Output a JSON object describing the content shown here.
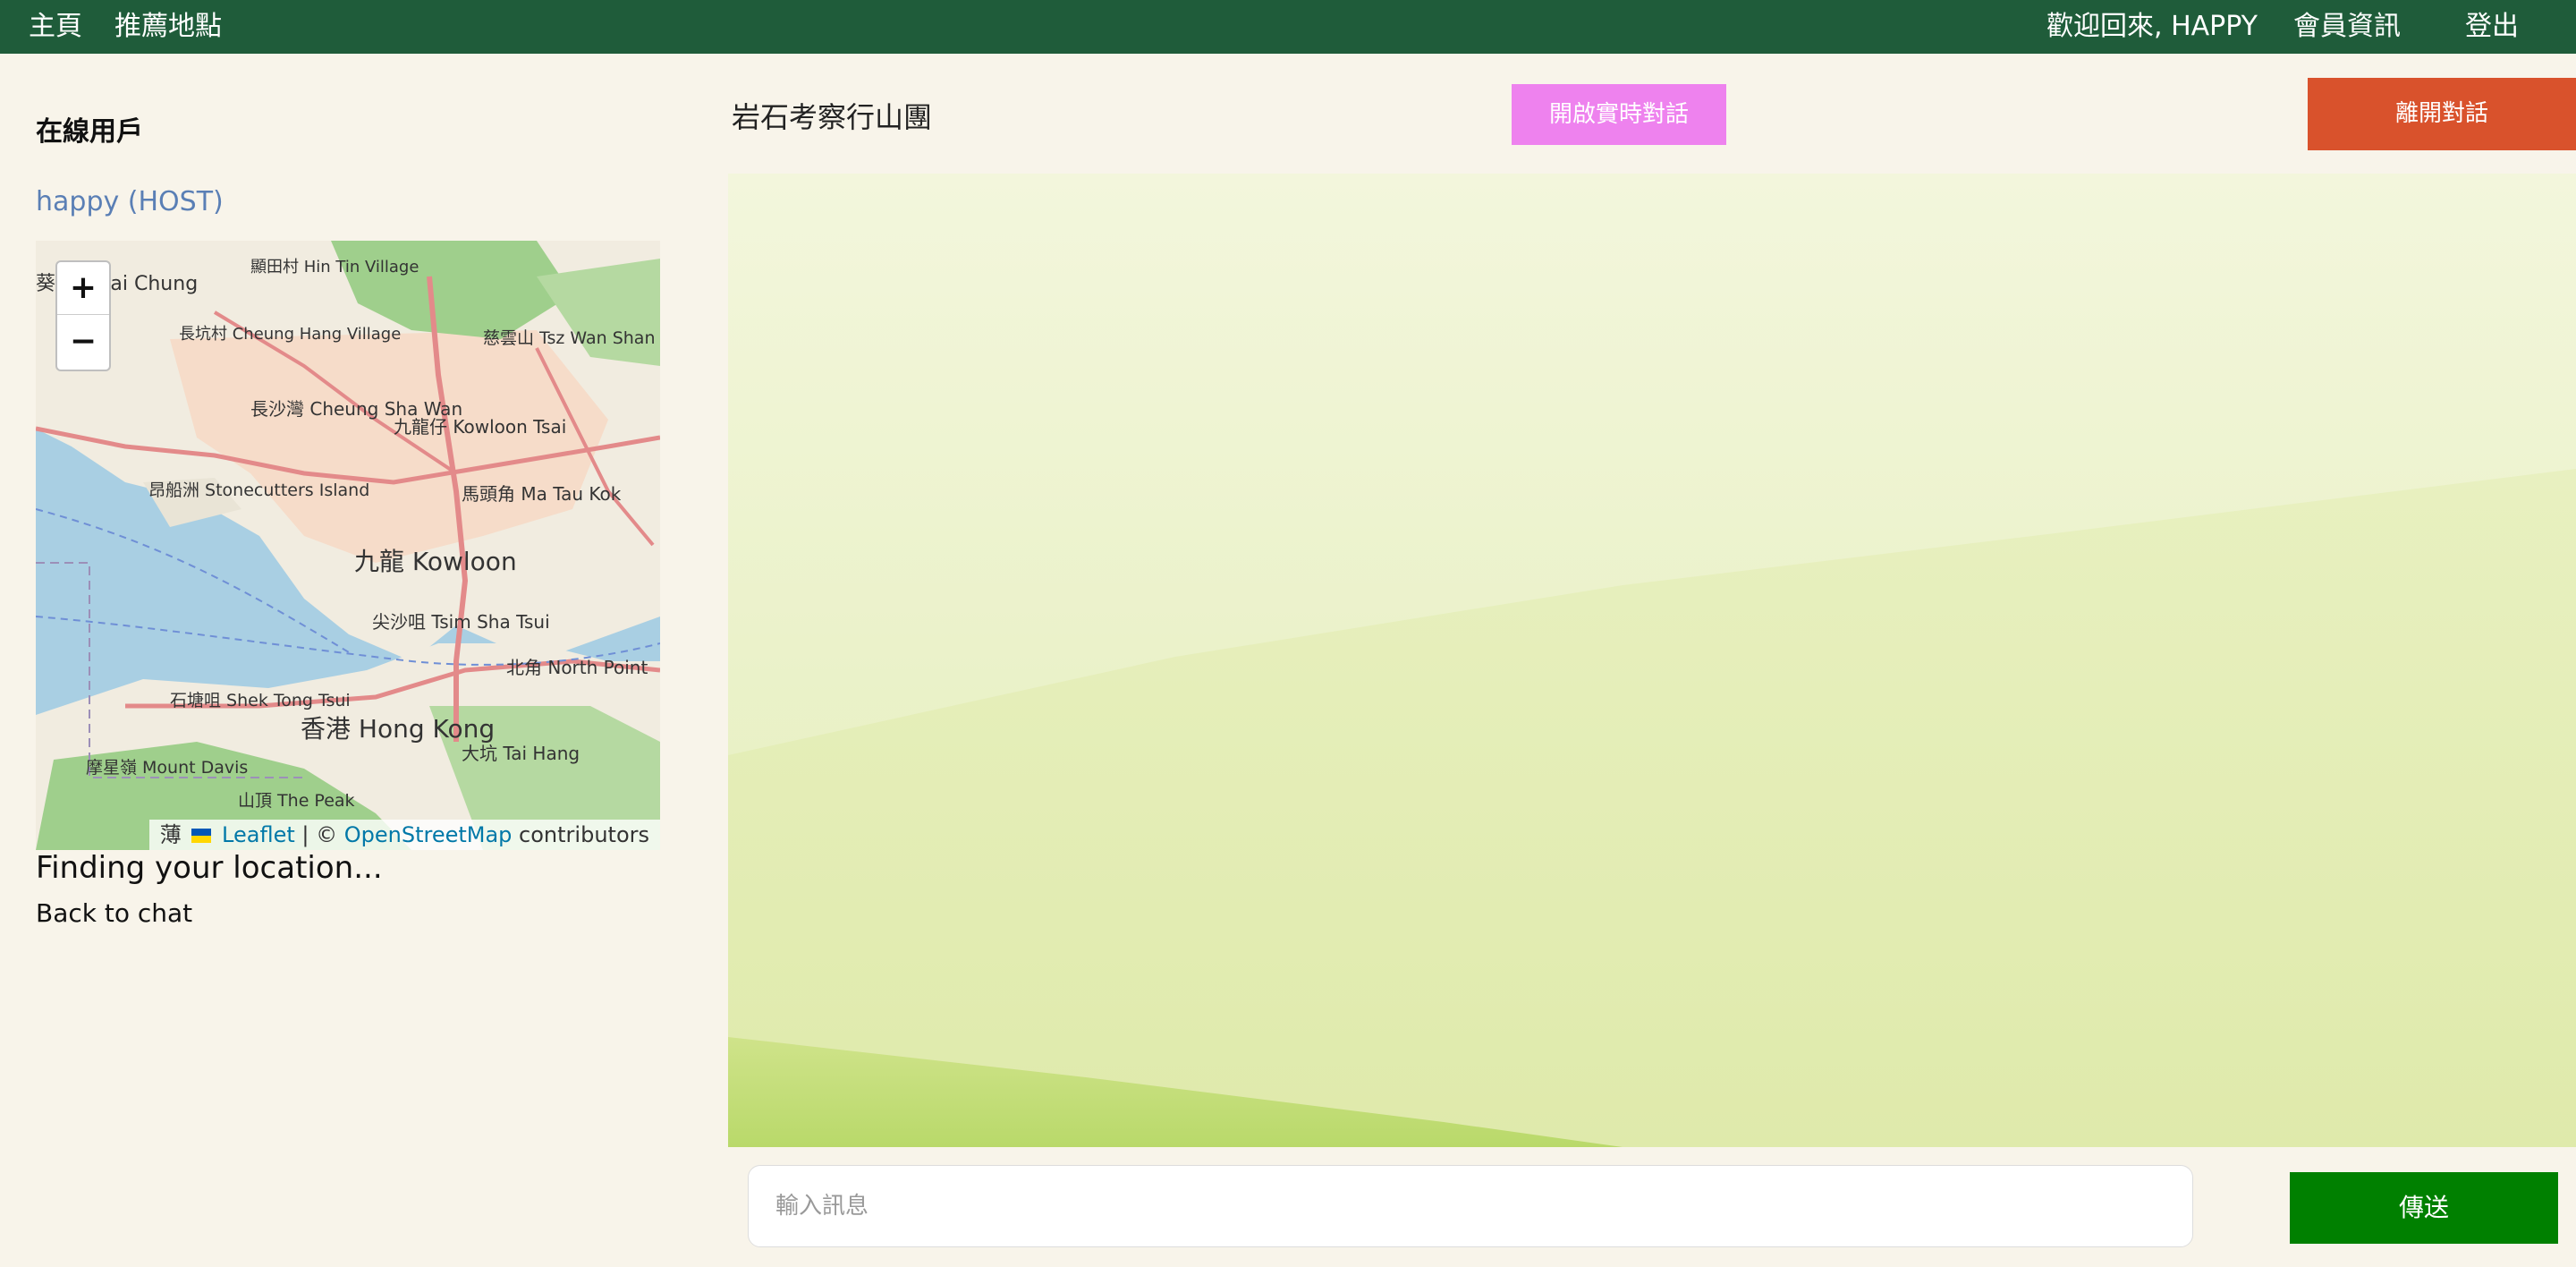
{
  "nav": {
    "home": "主頁",
    "recommended": "推薦地點",
    "welcome": "歡迎回來, HAPPY",
    "member_info": "會員資訊",
    "logout": "登出"
  },
  "left_panel": {
    "title": "在線用戶",
    "host_user": "happy (HOST)",
    "status": "Finding your location...",
    "back_link": "Back to chat"
  },
  "map": {
    "zoom_in": "+",
    "zoom_out": "−",
    "attribution": {
      "prefix": "薄",
      "leaflet": "Leaflet",
      "separator": " | © ",
      "osm": "OpenStreetMap",
      "suffix": " contributors"
    },
    "labels": [
      "九龍 Kowloon",
      "香港 Hong Kong",
      "葵涌 Kwai Chung",
      "長沙灣 Cheung Sha Wan",
      "九龍仔 Kowloon Tsai",
      "馬頭角 Ma Tau Kok",
      "尖沙咀 Tsim Sha Tsui",
      "北角 North Point",
      "大坑 Tai Hang",
      "石塘咀 Shek Tong Tsui",
      "摩星嶺 Mount Davis",
      "山頂 The Peak",
      "昂船洲 Stonecutters Island",
      "慈雲山 Tsz Wan Shan",
      "長坑村 Cheung Hang Village",
      "顯田村 Hin Tin Village"
    ],
    "colors": {
      "water": "#a9cfe3",
      "land": "#f1ece0",
      "park": "#9fcf8c",
      "road": "#e38a8a"
    }
  },
  "chat": {
    "room_name": "岩石考察行山團",
    "realtime_button": "開啟實時對話",
    "leave_button": "離開對話",
    "input_placeholder": "輸入訊息",
    "send_button": "傳送"
  },
  "colors": {
    "nav_bg": "#1f5c3a",
    "page_bg": "#f8f4ea",
    "realtime_button": "#ee82ee",
    "leave_button": "#d9522c",
    "send_button": "#008000"
  }
}
